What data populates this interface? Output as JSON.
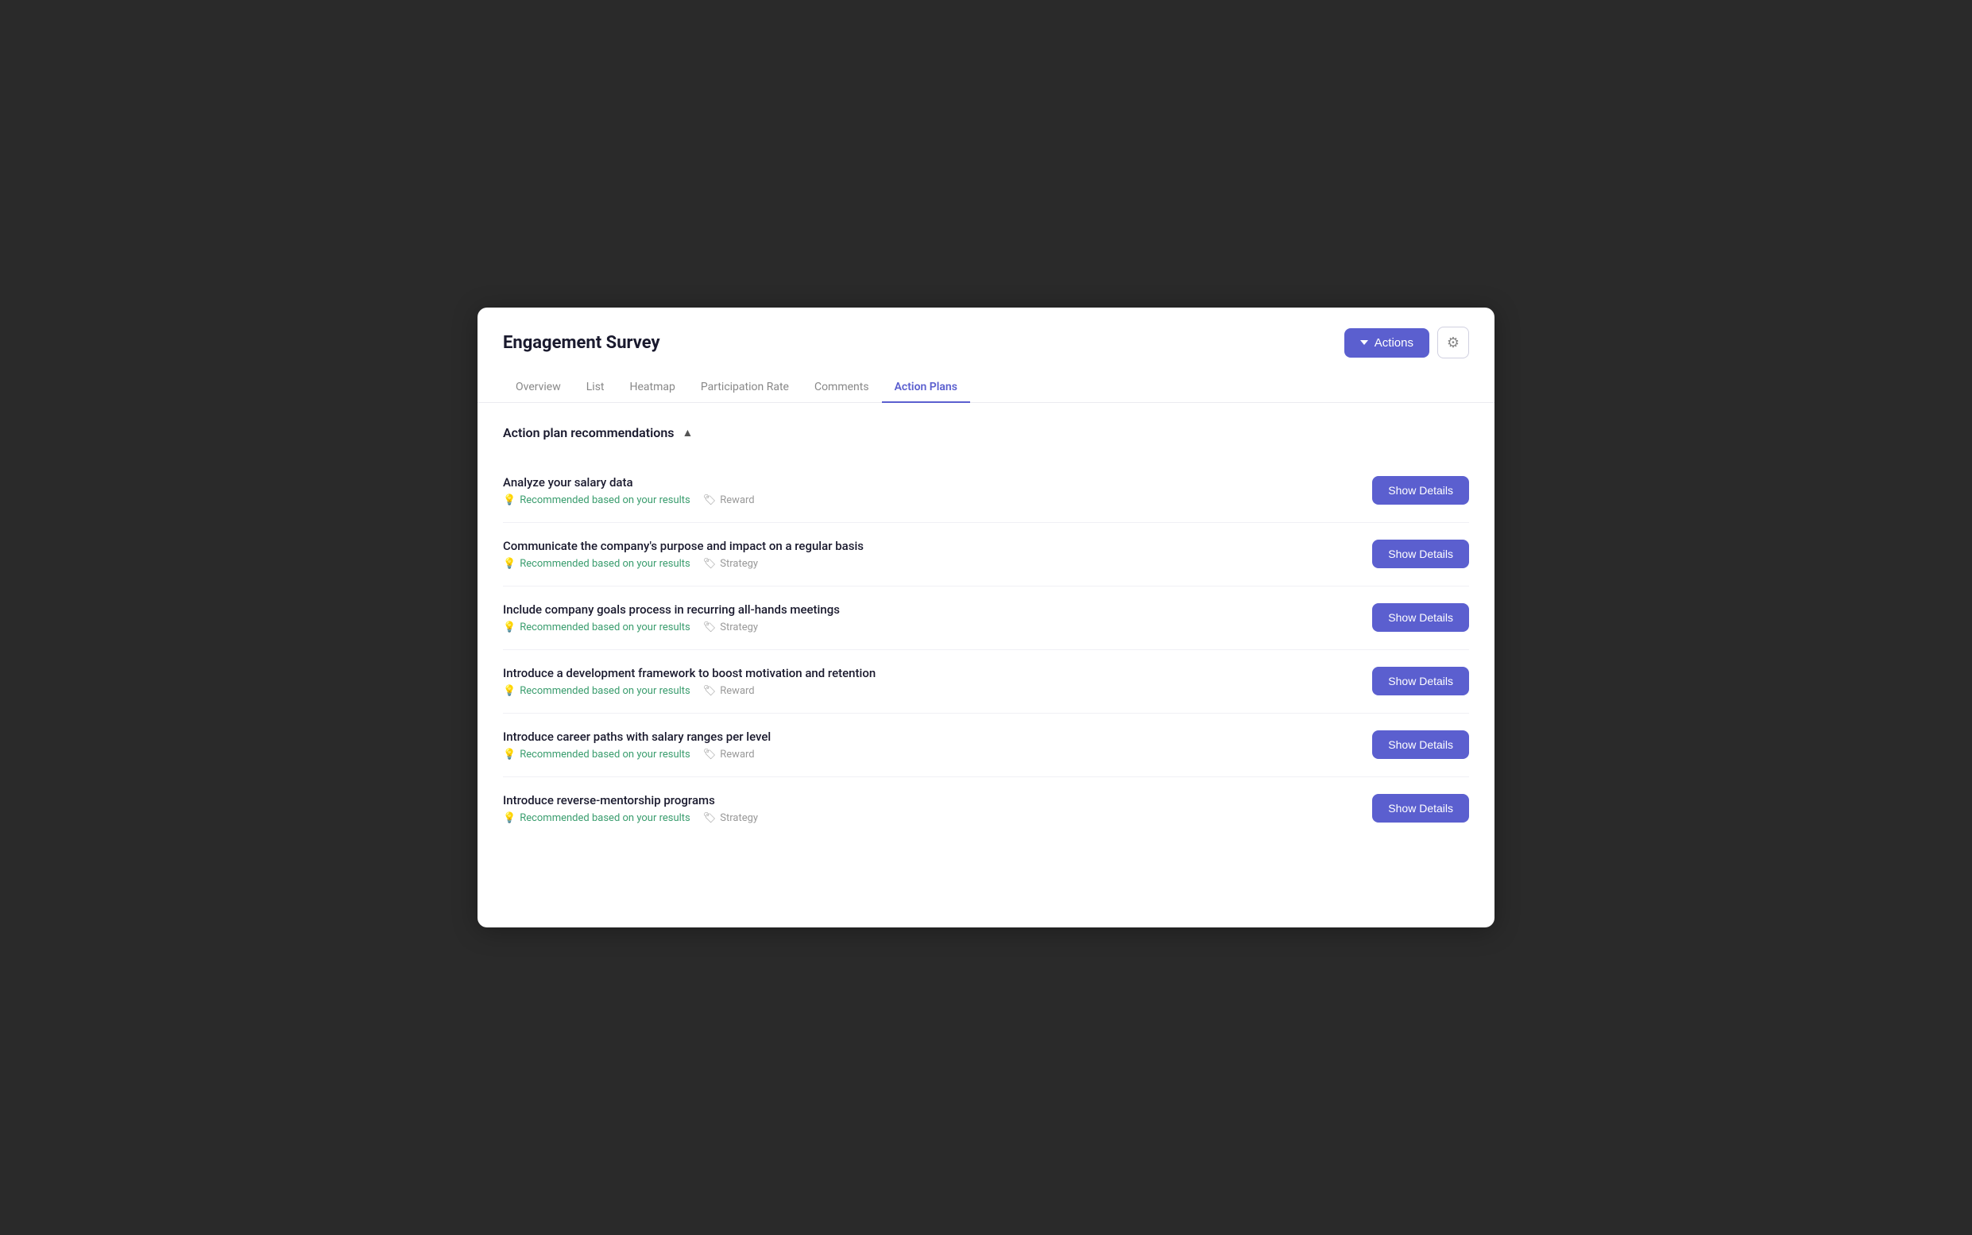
{
  "header": {
    "title": "Engagement Survey",
    "actions_label": "Actions",
    "gear_icon": "⚙"
  },
  "nav": {
    "tabs": [
      {
        "label": "Overview",
        "active": false
      },
      {
        "label": "List",
        "active": false
      },
      {
        "label": "Heatmap",
        "active": false
      },
      {
        "label": "Participation Rate",
        "active": false
      },
      {
        "label": "Comments",
        "active": false
      },
      {
        "label": "Action Plans",
        "active": true
      }
    ]
  },
  "section": {
    "title": "Action plan recommendations",
    "collapse_icon": "▲"
  },
  "plans": [
    {
      "name": "Analyze your salary data",
      "recommended_label": "Recommended based on your results",
      "category": "Reward",
      "button_label": "Show Details"
    },
    {
      "name": "Communicate the company's purpose and impact on a regular basis",
      "recommended_label": "Recommended based on your results",
      "category": "Strategy",
      "button_label": "Show Details"
    },
    {
      "name": "Include company goals process in recurring all-hands meetings",
      "recommended_label": "Recommended based on your results",
      "category": "Strategy",
      "button_label": "Show Details"
    },
    {
      "name": "Introduce a development framework to boost motivation and retention",
      "recommended_label": "Recommended based on your results",
      "category": "Reward",
      "button_label": "Show Details"
    },
    {
      "name": "Introduce career paths with salary ranges per level",
      "recommended_label": "Recommended based on your results",
      "category": "Reward",
      "button_label": "Show Details"
    },
    {
      "name": "Introduce reverse-mentorship programs",
      "recommended_label": "Recommended based on your results",
      "category": "Strategy",
      "button_label": "Show Details"
    }
  ],
  "icons": {
    "chevron_down": "▾",
    "gear": "⚙",
    "bulb": "💡",
    "tag": "🏷"
  }
}
